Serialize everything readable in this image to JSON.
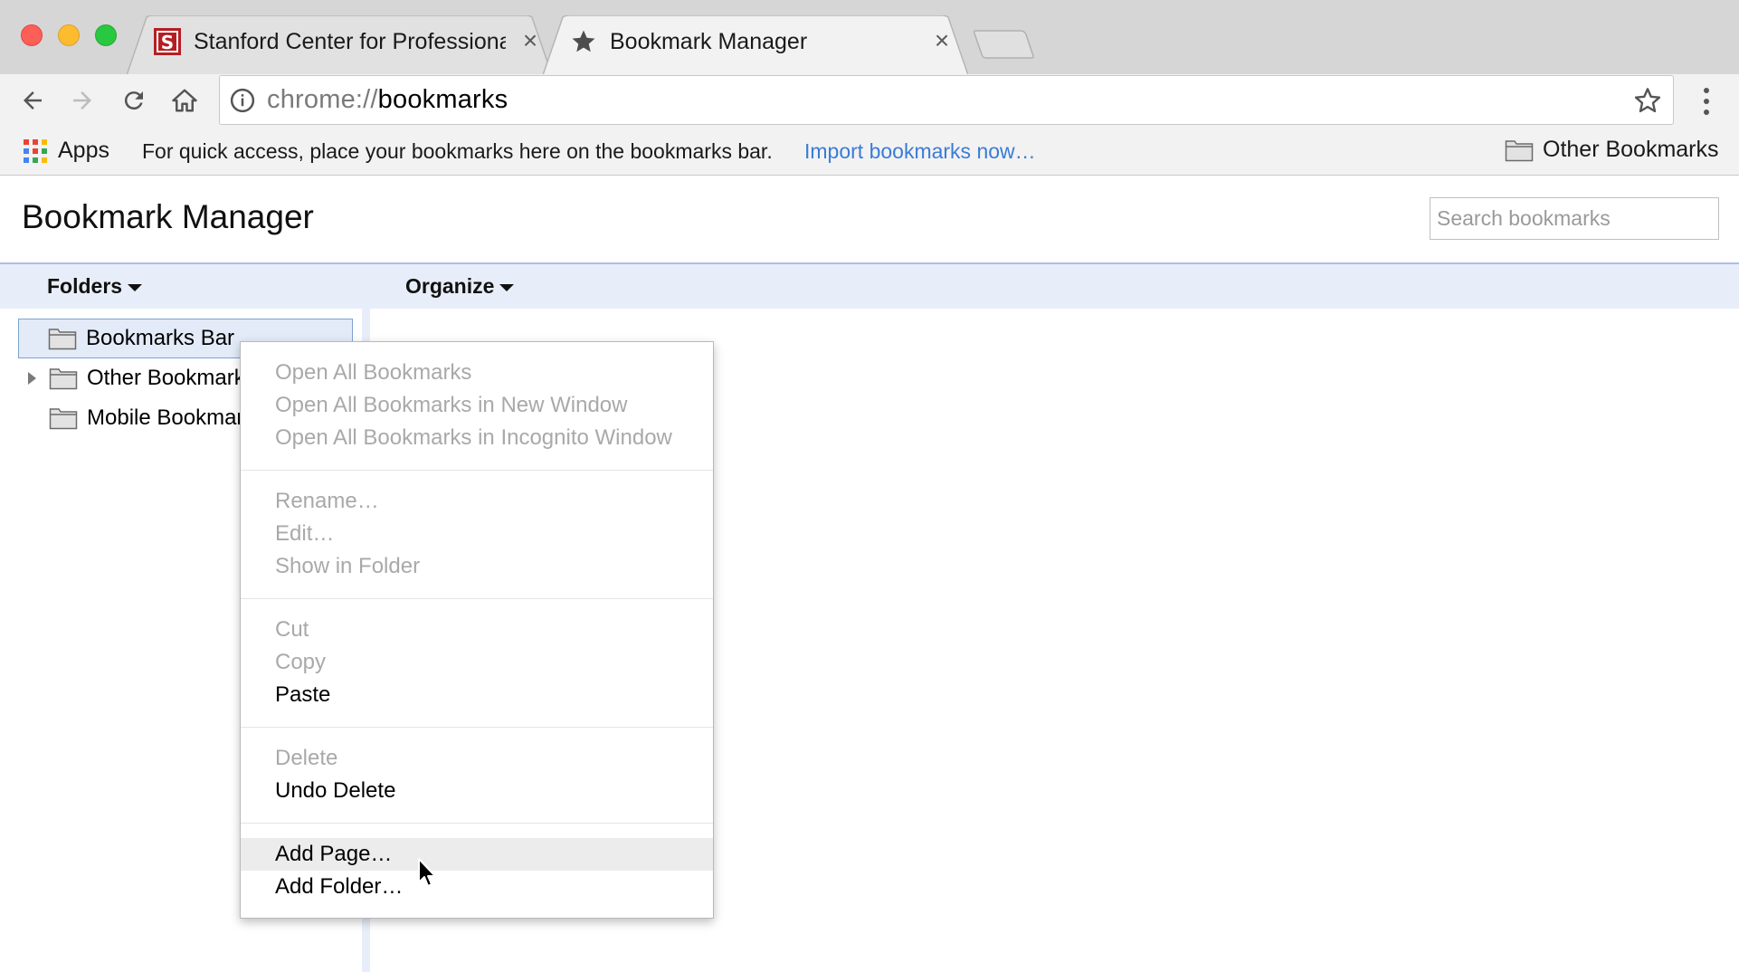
{
  "tabs": [
    {
      "title": "Stanford Center for Professional Development",
      "favicon": "stanford-s-icon",
      "active": false
    },
    {
      "title": "Bookmark Manager",
      "favicon": "star-icon",
      "active": true
    }
  ],
  "toolbar": {
    "url_scheme": "chrome://",
    "url_host": "bookmarks"
  },
  "bookmarks_bar": {
    "apps_label": "Apps",
    "hint": "For quick access, place your bookmarks here on the bookmarks bar.",
    "import_link": "Import bookmarks now…",
    "other_bookmarks": "Other Bookmarks"
  },
  "page": {
    "title": "Bookmark Manager",
    "search_placeholder": "Search bookmarks",
    "folders_menu": "Folders",
    "organize_menu": "Organize"
  },
  "tree": [
    {
      "label": "Bookmarks Bar",
      "selected": true,
      "expandable": false
    },
    {
      "label": "Other Bookmarks",
      "selected": false,
      "expandable": true
    },
    {
      "label": "Mobile Bookmarks",
      "selected": false,
      "expandable": false
    }
  ],
  "context_menu": {
    "groups": [
      [
        {
          "label": "Open All Bookmarks",
          "enabled": false
        },
        {
          "label": "Open All Bookmarks in New Window",
          "enabled": false
        },
        {
          "label": "Open All Bookmarks in Incognito Window",
          "enabled": false
        }
      ],
      [
        {
          "label": "Rename…",
          "enabled": false
        },
        {
          "label": "Edit…",
          "enabled": false
        },
        {
          "label": "Show in Folder",
          "enabled": false
        }
      ],
      [
        {
          "label": "Cut",
          "enabled": false
        },
        {
          "label": "Copy",
          "enabled": false
        },
        {
          "label": "Paste",
          "enabled": true
        }
      ],
      [
        {
          "label": "Delete",
          "enabled": false
        },
        {
          "label": "Undo Delete",
          "enabled": true
        }
      ],
      [
        {
          "label": "Add Page…",
          "enabled": true,
          "hovered": true
        },
        {
          "label": "Add Folder…",
          "enabled": true
        }
      ]
    ]
  },
  "colors": {
    "link": "#3a7bd5",
    "selection": "#e3ebf8",
    "header_band": "#e8eef9"
  }
}
